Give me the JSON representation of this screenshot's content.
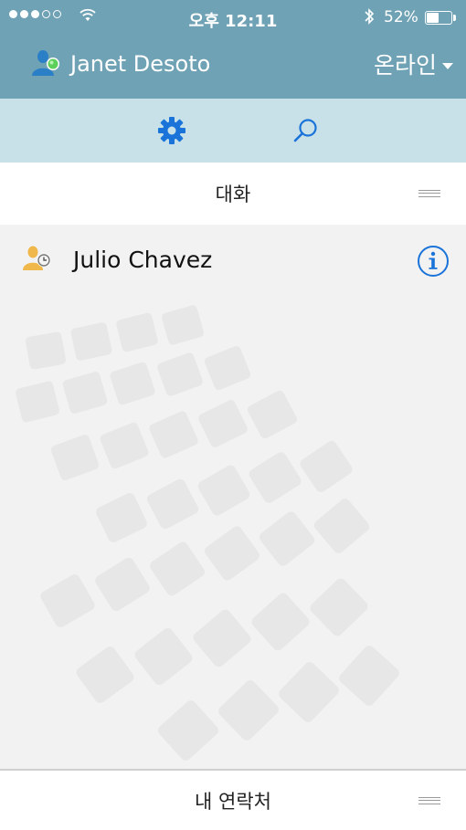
{
  "status_bar": {
    "time": "오후 12:11",
    "battery_percent": "52%",
    "battery_level": 0.52,
    "signal_filled": 3,
    "signal_total": 5
  },
  "header": {
    "user_name": "Janet Desoto",
    "presence_label": "온라인",
    "user_icon": "user-online-icon",
    "presence_color": "#5cd05a"
  },
  "toolbar": {
    "settings_icon": "gear-icon",
    "search_icon": "search-icon",
    "accent": "#1a73d9"
  },
  "conversations": {
    "section_title": "대화",
    "items": [
      {
        "name": "Julio Chavez",
        "status_icon": "user-away-clock-icon",
        "action_icon": "info-icon"
      }
    ]
  },
  "contacts": {
    "section_title": "내 연락처"
  },
  "colors": {
    "header_bg": "#6fa2b5",
    "toolbar_bg": "#c8e1e8",
    "content_bg": "#f2f2f2"
  }
}
